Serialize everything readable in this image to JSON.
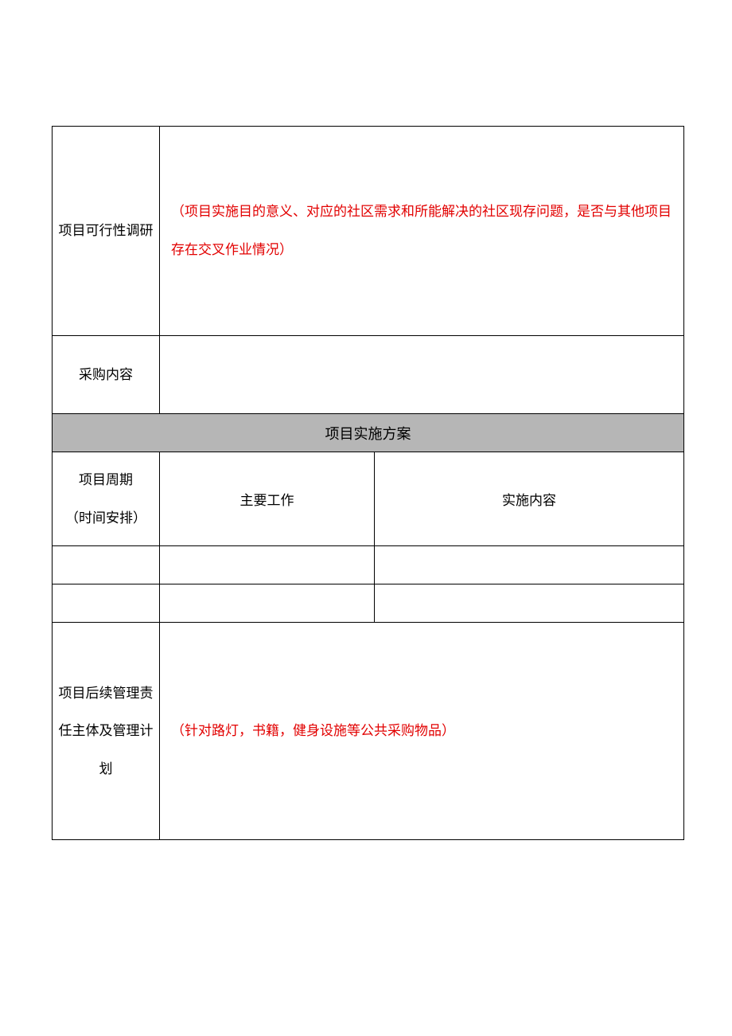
{
  "rows": {
    "feasibility": {
      "label": "项目可行性调研",
      "note": "（项目实施目的意义、对应的社区需求和所能解决的社区现存问题，是否与其他项目存在交叉作业情况）"
    },
    "procurement": {
      "label": "采购内容",
      "value": ""
    },
    "section_header": "项目实施方案",
    "plan_headers": {
      "period_line1": "项目周期",
      "period_line2": "（时间安排）",
      "work": "主要工作",
      "content": "实施内容"
    },
    "plan_rows": [
      {
        "period": "",
        "work": "",
        "content": ""
      },
      {
        "period": "",
        "work": "",
        "content": ""
      }
    ],
    "management": {
      "label": "项目后续管理责任主体及管理计划",
      "note": "（针对路灯，书籍，健身设施等公共采购物品）"
    }
  }
}
